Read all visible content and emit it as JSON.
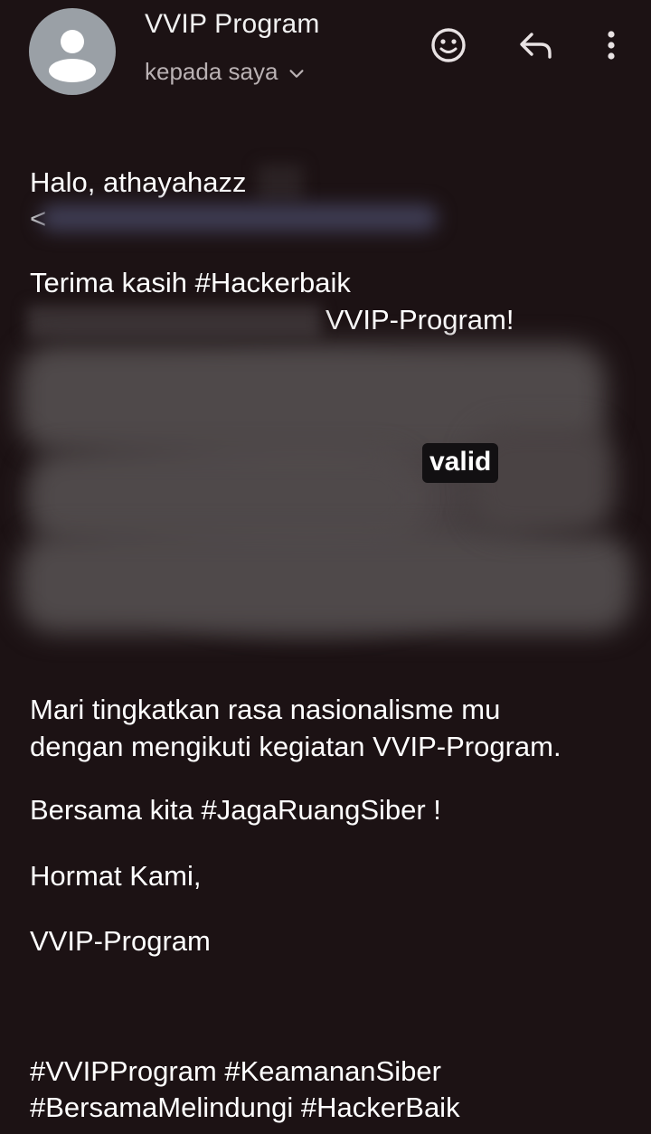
{
  "header": {
    "sender_name": "VVIP Program",
    "recipient_label": "kepada saya",
    "icons": [
      "person-icon",
      "chevron-down-icon",
      "emoji-icon",
      "reply-icon",
      "more-vert-icon"
    ]
  },
  "email": {
    "greeting": "Halo, athayahazz",
    "address_fragment": "<",
    "thanks_line": "Terima kasih #Hackerbaik",
    "program_line": "VVIP-Program!",
    "valid_word": "valid",
    "paragraph_line_1": "Mari tingkatkan rasa nasionalisme mu",
    "paragraph_line_2": "dengan mengikuti kegiatan VVIP-Program.",
    "together_line": "Bersama kita #JagaRuangSiber !",
    "regards": "Hormat Kami,",
    "signature": "VVIP-Program",
    "hashtags_line_1": "#VVIPProgram #KeamananSiber",
    "hashtags_line_2": "#BersamaMelindungi #HackerBaik"
  },
  "colors": {
    "background": "#1c1214",
    "text": "#ffffff",
    "secondary_text": "#b9b1b3",
    "avatar_bg": "#9aa0a6",
    "redaction_gray": "#4f494a",
    "redaction_blue": "#3f3d54"
  }
}
